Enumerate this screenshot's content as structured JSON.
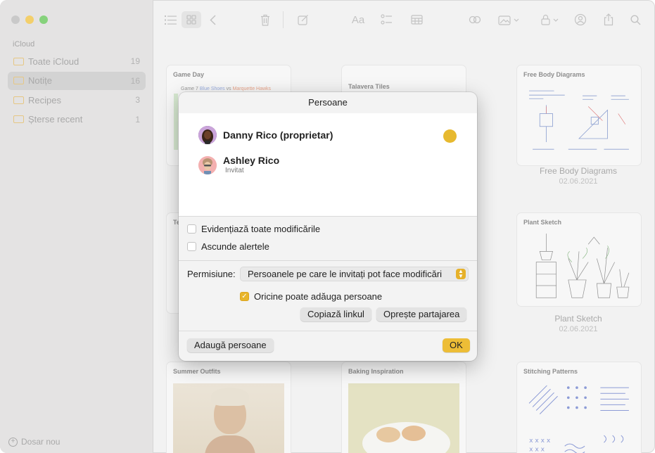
{
  "window": {
    "toolbar_icons": [
      "list-view-icon",
      "gallery-view-icon",
      "back-icon",
      "trash-icon",
      "compose-icon",
      "format-icon",
      "checklist-icon",
      "table-icon",
      "link-icon",
      "media-icon",
      "lock-icon",
      "collaborate-icon",
      "share-icon",
      "search-icon"
    ]
  },
  "sidebar": {
    "section": "iCloud",
    "items": [
      {
        "label": "Toate iCloud",
        "count": "19"
      },
      {
        "label": "Notițe",
        "count": "16"
      },
      {
        "label": "Recipes",
        "count": "3"
      },
      {
        "label": "Șterse recent",
        "count": "1"
      }
    ],
    "new_folder": "Dosar nou"
  },
  "gallery": {
    "cards": [
      {
        "title": "Game Day"
      },
      {
        "title": "Talavera Tiles"
      },
      {
        "title": "Free Body Diagrams",
        "caption": "Free Body Diagrams",
        "date": "02.06.2021"
      },
      {
        "title": "Te"
      },
      {
        "title": "Plant Sketch",
        "caption": "Plant Sketch",
        "date": "02.06.2021"
      },
      {
        "title": "Summer Outfits"
      },
      {
        "title": "Baking Inspiration"
      },
      {
        "title": "Stitching Patterns"
      }
    ],
    "game_day_note": {
      "prefix": "Game 7",
      "team_a": "Blue Shoes",
      "vs": "vs",
      "team_b": "Marquette Hawks"
    }
  },
  "dialog": {
    "title": "Persoane",
    "people": [
      {
        "name": "Danny Rico (proprietar)",
        "status": ""
      },
      {
        "name": "Ashley Rico",
        "status": "Invitat"
      }
    ],
    "highlight_changes": "Evidențiază toate modificările",
    "hide_alerts": "Ascunde alertele",
    "permission_label": "Permisiune:",
    "permission_value": "Persoanele pe care le invitați pot face modificări",
    "anyone_can_add": "Oricine poate adăuga persoane",
    "copy_link": "Copiază linkul",
    "stop_sharing": "Oprește partajarea",
    "add_people": "Adaugă persoane",
    "ok": "OK",
    "accent": "#e8b52c"
  }
}
